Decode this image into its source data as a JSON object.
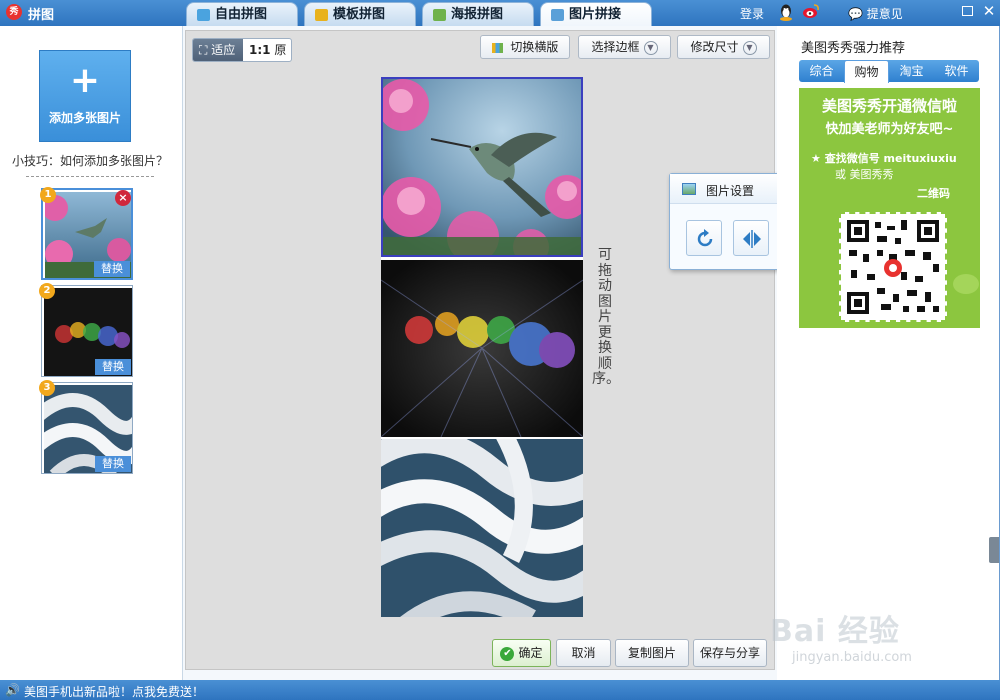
{
  "app": {
    "title": "拼图",
    "logo_text": "秀"
  },
  "tabs": [
    {
      "label": "自由拼图",
      "icon": "free-collage-icon",
      "color": "#4aa3df",
      "active": false
    },
    {
      "label": "模板拼图",
      "icon": "template-collage-icon",
      "color": "#e8b21d",
      "active": false
    },
    {
      "label": "海报拼图",
      "icon": "poster-collage-icon",
      "color": "#6fb24c",
      "active": false
    },
    {
      "label": "图片拼接",
      "icon": "image-stitch-icon",
      "color": "#5aa0d8",
      "active": true
    }
  ],
  "titlebar_right": {
    "login": "登录",
    "feedback": "提意见"
  },
  "left_panel": {
    "add_button": {
      "plus": "+",
      "label": "添加多张图片"
    },
    "tip": "小技巧：如何添加多张图片？",
    "thumbnails": [
      {
        "number": "1",
        "replace": "替换",
        "delete": "×",
        "selected": true
      },
      {
        "number": "2",
        "replace": "替换",
        "selected": false
      },
      {
        "number": "3",
        "replace": "替换",
        "selected": false
      }
    ]
  },
  "toolbar": {
    "fit": "适应",
    "fit_icon": "fit-screen-icon",
    "original_prefix": "1:1",
    "original": "原大",
    "switch_orientation": "切换横版",
    "select_border": "选择边框",
    "modify_size": "修改尺寸"
  },
  "hint": "可拖动图片更换顺序。",
  "popup": {
    "title": "图片设置",
    "close": "×",
    "buttons": [
      "rotate-icon",
      "flip-icon",
      "copy-icon",
      "delete-icon"
    ]
  },
  "right_panel": {
    "title": "美图秀秀强力推荐",
    "tabs": [
      {
        "label": "综合",
        "active": false
      },
      {
        "label": "购物",
        "active": true
      },
      {
        "label": "淘宝",
        "active": false
      },
      {
        "label": "软件",
        "active": false
      }
    ],
    "ad": {
      "line1": "美图秀秀开通微信啦",
      "line2": "快加美老师为好友吧~",
      "line3": "★  查找微信号 meituxiuxiu",
      "line4": "或  美图秀秀",
      "line5": "二维码",
      "bg_color": "#8cc63f"
    }
  },
  "actions": {
    "confirm": "确定",
    "cancel": "取消",
    "copy": "复制图片",
    "save_share": "保存与分享"
  },
  "statusbar": {
    "text": "美图手机出新品啦！点我免费送！"
  },
  "watermark": {
    "brand": "Bai 经验",
    "url": "jingyan.baidu.com"
  }
}
